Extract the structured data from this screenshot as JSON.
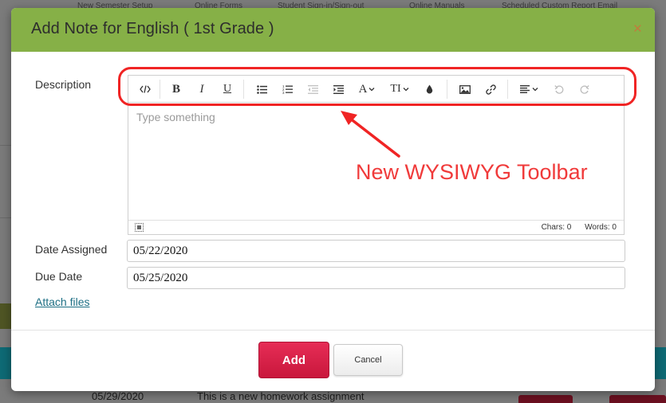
{
  "background": {
    "nav_items": [
      "New Semester Setup",
      "Online Forms",
      "Student Sign-in/Sign-out",
      "Online Manuals",
      "Scheduled Custom Report Email"
    ],
    "row": {
      "date": "05/29/2020",
      "text": "This is a new homework assignment"
    }
  },
  "modal": {
    "title": "Add Note for English ( 1st Grade )",
    "close_icon": "close-icon",
    "description_label": "Description",
    "editor": {
      "placeholder": "Type something",
      "chars_label": "Chars: 0",
      "words_label": "Words: 0",
      "toolbar": [
        {
          "name": "code-view-icon",
          "glyph": "</>"
        },
        {
          "name": "bold-icon",
          "glyph": "B"
        },
        {
          "name": "italic-icon",
          "glyph": "I"
        },
        {
          "name": "underline-icon",
          "glyph": "U"
        },
        {
          "name": "bulleted-list-icon",
          "glyph": "•≡"
        },
        {
          "name": "numbered-list-icon",
          "glyph": "1≡"
        },
        {
          "name": "outdent-icon",
          "glyph": "⇤"
        },
        {
          "name": "indent-icon",
          "glyph": "⇥"
        },
        {
          "name": "font-color-icon",
          "glyph": "A"
        },
        {
          "name": "font-size-icon",
          "glyph": "TI"
        },
        {
          "name": "highlight-color-icon",
          "glyph": "●"
        },
        {
          "name": "insert-image-icon",
          "glyph": "img"
        },
        {
          "name": "insert-link-icon",
          "glyph": "link"
        },
        {
          "name": "align-icon",
          "glyph": "≡"
        },
        {
          "name": "undo-icon",
          "glyph": "↶"
        },
        {
          "name": "redo-icon",
          "glyph": "↷"
        }
      ]
    },
    "date_assigned_label": "Date Assigned",
    "date_assigned_value": "05/22/2020",
    "due_date_label": "Due Date",
    "due_date_value": "05/25/2020",
    "attach_files_label": "Attach files",
    "add_label": "Add",
    "cancel_label": "Cancel"
  },
  "annotation": {
    "text": "New WYSIWYG Toolbar",
    "color": "#f02424"
  },
  "colors": {
    "header": "#86b047",
    "primary_button": "#d81f47",
    "link": "#1d6f84"
  }
}
